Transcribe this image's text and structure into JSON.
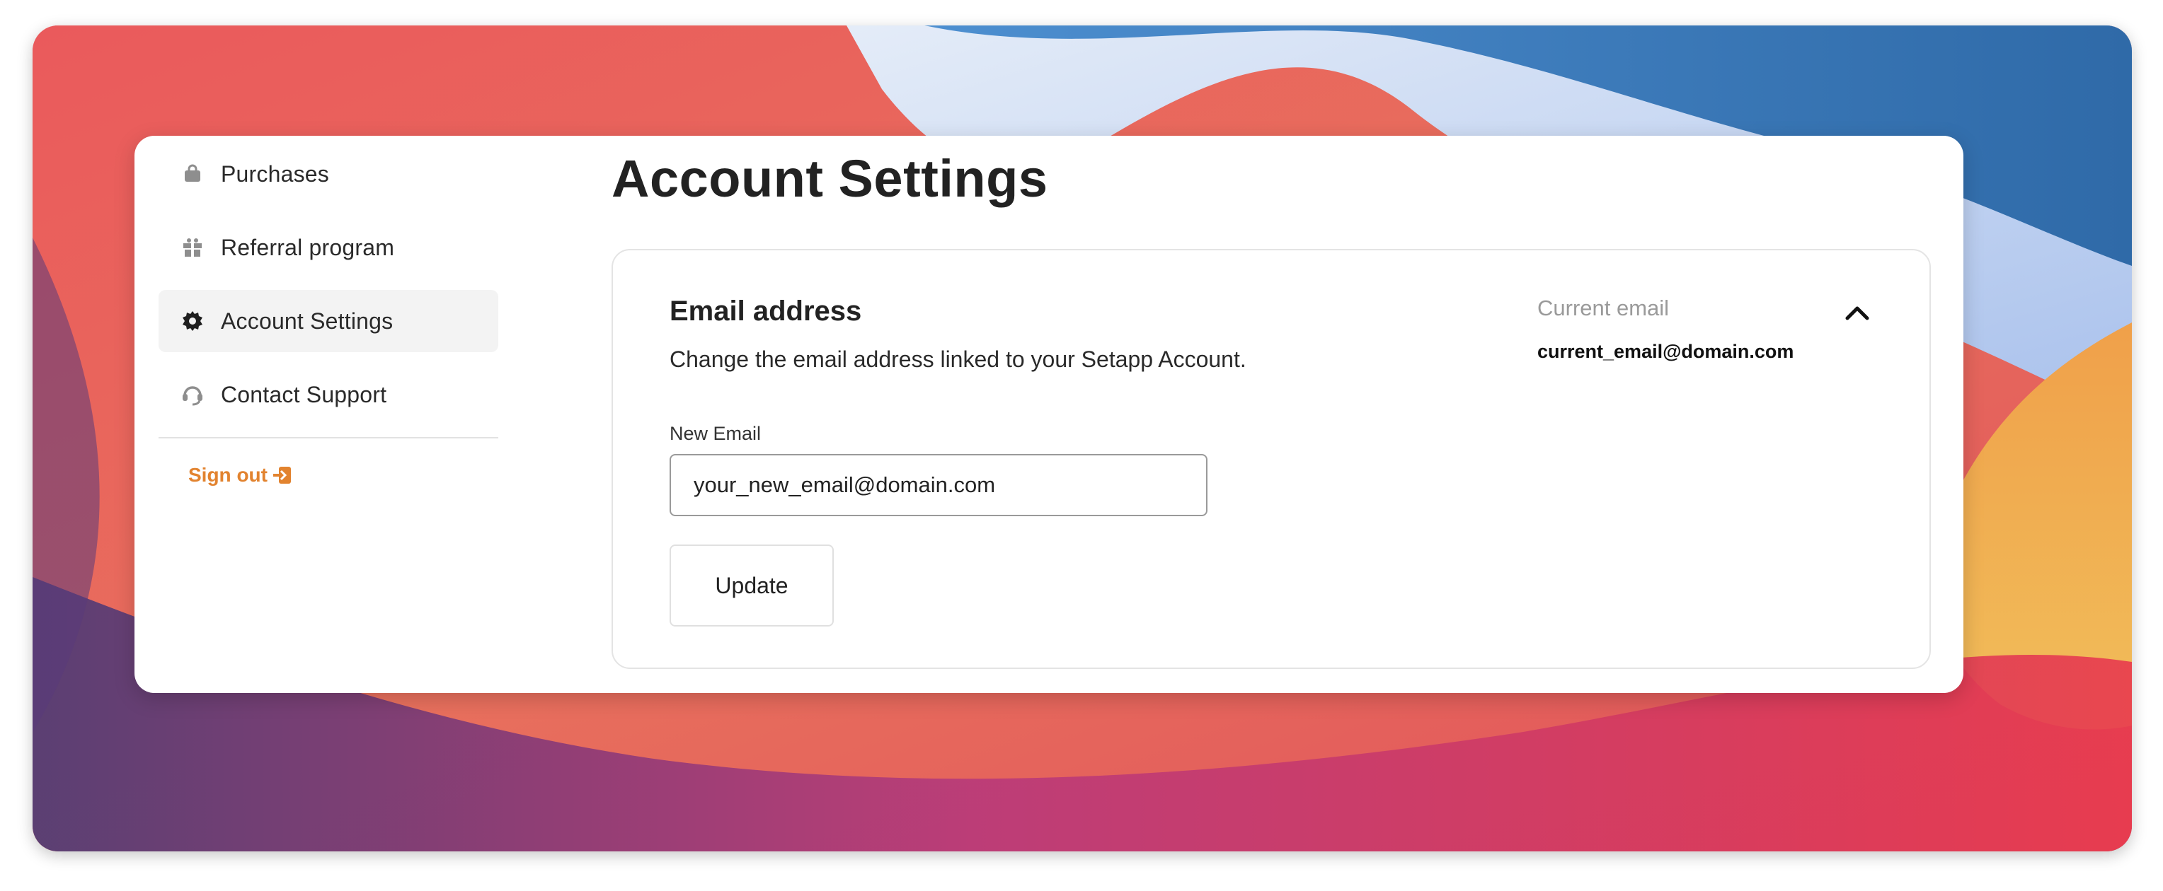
{
  "colors": {
    "accent_orange": "#e2832f",
    "active_nav_bg": "#f3f3f3",
    "muted_text": "#9a9a9a"
  },
  "sidebar": {
    "items": [
      {
        "label": "Purchases",
        "icon": "bag-icon"
      },
      {
        "label": "Referral program",
        "icon": "gift-icon"
      },
      {
        "label": "Account Settings",
        "icon": "gear-icon",
        "active": true
      },
      {
        "label": "Contact Support",
        "icon": "headset-icon"
      }
    ],
    "sign_out": {
      "label": "Sign out",
      "icon": "sign-out-icon"
    }
  },
  "main": {
    "title": "Account Settings",
    "email_section": {
      "title": "Email address",
      "description": "Change the email address linked to your Setapp Account.",
      "field_label": "New Email",
      "input_value": "your_new_email@domain.com",
      "update_label": "Update",
      "current_label": "Current email",
      "current_value": "current_email@domain.com",
      "toggle_icon": "chevron-up-icon"
    }
  }
}
